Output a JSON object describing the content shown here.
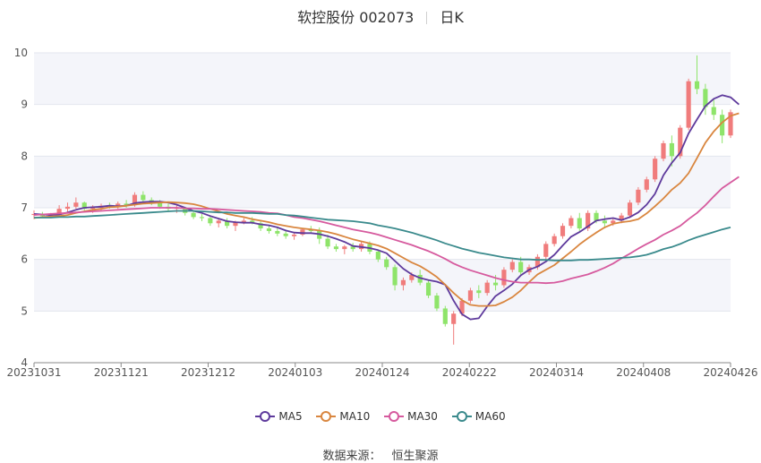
{
  "header": {
    "title": "软控股份 002073",
    "period": "日K"
  },
  "source": {
    "label": "数据来源：",
    "value": "恒生聚源"
  },
  "chart_data": {
    "type": "candlestick",
    "ylim": [
      4,
      10
    ],
    "yticks": [
      4,
      5,
      6,
      7,
      8,
      9,
      10
    ],
    "xtick_labels": [
      "20231031",
      "20231121",
      "20231212",
      "20240103",
      "20240124",
      "20240222",
      "20240314",
      "20240408",
      "20240426"
    ],
    "grid": true,
    "legend_position": "bottom-center",
    "colors": {
      "up": "#f07c7c",
      "down": "#8ee46a",
      "band": "#f4f5fa"
    },
    "ohlc": [
      [
        6.86,
        6.95,
        6.78,
        6.88
      ],
      [
        6.88,
        6.92,
        6.82,
        6.84
      ],
      [
        6.84,
        6.9,
        6.8,
        6.86
      ],
      [
        6.86,
        7.05,
        6.85,
        6.98
      ],
      [
        6.98,
        7.1,
        6.92,
        7.02
      ],
      [
        7.02,
        7.2,
        6.98,
        7.1
      ],
      [
        7.1,
        7.12,
        6.95,
        6.98
      ],
      [
        6.98,
        7.05,
        6.9,
        7.0
      ],
      [
        7.0,
        7.08,
        6.95,
        7.04
      ],
      [
        7.04,
        7.1,
        6.98,
        7.02
      ],
      [
        7.02,
        7.12,
        6.98,
        7.08
      ],
      [
        7.08,
        7.15,
        7.0,
        7.05
      ],
      [
        7.05,
        7.3,
        7.02,
        7.25
      ],
      [
        7.25,
        7.32,
        7.1,
        7.15
      ],
      [
        7.15,
        7.2,
        7.05,
        7.1
      ],
      [
        7.1,
        7.15,
        6.98,
        7.02
      ],
      [
        7.02,
        7.08,
        6.92,
        6.98
      ],
      [
        6.98,
        7.05,
        6.9,
        7.0
      ],
      [
        7.0,
        7.02,
        6.85,
        6.9
      ],
      [
        6.9,
        6.95,
        6.78,
        6.82
      ],
      [
        6.82,
        6.88,
        6.74,
        6.8
      ],
      [
        6.8,
        6.85,
        6.65,
        6.7
      ],
      [
        6.7,
        6.78,
        6.62,
        6.75
      ],
      [
        6.75,
        6.8,
        6.6,
        6.65
      ],
      [
        6.65,
        6.75,
        6.55,
        6.72
      ],
      [
        6.72,
        6.8,
        6.68,
        6.75
      ],
      [
        6.75,
        6.82,
        6.68,
        6.7
      ],
      [
        6.7,
        6.75,
        6.55,
        6.6
      ],
      [
        6.6,
        6.66,
        6.5,
        6.55
      ],
      [
        6.55,
        6.62,
        6.45,
        6.5
      ],
      [
        6.5,
        6.55,
        6.4,
        6.45
      ],
      [
        6.45,
        6.52,
        6.38,
        6.48
      ],
      [
        6.48,
        6.6,
        6.45,
        6.58
      ],
      [
        6.58,
        6.65,
        6.5,
        6.55
      ],
      [
        6.55,
        6.62,
        6.3,
        6.4
      ],
      [
        6.4,
        6.48,
        6.2,
        6.25
      ],
      [
        6.25,
        6.3,
        6.15,
        6.2
      ],
      [
        6.2,
        6.28,
        6.1,
        6.25
      ],
      [
        6.25,
        6.32,
        6.15,
        6.2
      ],
      [
        6.2,
        6.35,
        6.15,
        6.3
      ],
      [
        6.3,
        6.35,
        6.1,
        6.15
      ],
      [
        6.15,
        6.18,
        5.95,
        6.0
      ],
      [
        6.0,
        6.05,
        5.8,
        5.85
      ],
      [
        5.85,
        5.9,
        5.4,
        5.5
      ],
      [
        5.5,
        5.65,
        5.4,
        5.6
      ],
      [
        5.6,
        5.75,
        5.55,
        5.7
      ],
      [
        5.7,
        5.8,
        5.5,
        5.55
      ],
      [
        5.55,
        5.6,
        5.25,
        5.3
      ],
      [
        5.3,
        5.35,
        5.0,
        5.05
      ],
      [
        5.05,
        5.1,
        4.7,
        4.75
      ],
      [
        4.75,
        5.0,
        4.35,
        4.95
      ],
      [
        4.95,
        5.25,
        4.9,
        5.2
      ],
      [
        5.2,
        5.45,
        5.15,
        5.4
      ],
      [
        5.4,
        5.5,
        5.25,
        5.35
      ],
      [
        5.35,
        5.6,
        5.3,
        5.55
      ],
      [
        5.55,
        5.7,
        5.4,
        5.5
      ],
      [
        5.5,
        5.85,
        5.45,
        5.8
      ],
      [
        5.8,
        6.0,
        5.75,
        5.95
      ],
      [
        5.95,
        6.05,
        5.7,
        5.75
      ],
      [
        5.75,
        5.9,
        5.7,
        5.85
      ],
      [
        5.85,
        6.1,
        5.8,
        6.05
      ],
      [
        6.05,
        6.35,
        6.0,
        6.3
      ],
      [
        6.3,
        6.5,
        6.25,
        6.45
      ],
      [
        6.45,
        6.7,
        6.4,
        6.65
      ],
      [
        6.65,
        6.85,
        6.6,
        6.8
      ],
      [
        6.8,
        6.9,
        6.55,
        6.6
      ],
      [
        6.6,
        6.95,
        6.55,
        6.9
      ],
      [
        6.9,
        6.95,
        6.7,
        6.75
      ],
      [
        6.75,
        6.85,
        6.6,
        6.7
      ],
      [
        6.7,
        6.8,
        6.65,
        6.75
      ],
      [
        6.75,
        6.9,
        6.7,
        6.85
      ],
      [
        6.85,
        7.15,
        6.8,
        7.1
      ],
      [
        7.1,
        7.4,
        7.05,
        7.35
      ],
      [
        7.35,
        7.6,
        7.3,
        7.55
      ],
      [
        7.55,
        8.0,
        7.5,
        7.95
      ],
      [
        7.95,
        8.3,
        7.9,
        8.25
      ],
      [
        8.25,
        8.4,
        7.8,
        8.0
      ],
      [
        8.0,
        8.6,
        7.95,
        8.55
      ],
      [
        8.55,
        9.5,
        8.5,
        9.45
      ],
      [
        9.45,
        9.95,
        9.2,
        9.3
      ],
      [
        9.3,
        9.4,
        8.8,
        8.95
      ],
      [
        8.95,
        9.1,
        8.7,
        8.8
      ],
      [
        8.8,
        8.9,
        8.25,
        8.4
      ],
      [
        8.4,
        8.9,
        8.35,
        8.85
      ]
    ],
    "series": [
      {
        "name": "MA5",
        "color": "#5e3a9c",
        "values": [
          6.88,
          6.87,
          6.86,
          6.87,
          6.91,
          6.96,
          7.0,
          7.01,
          7.02,
          7.04,
          7.03,
          7.04,
          7.09,
          7.11,
          7.12,
          7.12,
          7.1,
          7.06,
          7.0,
          6.94,
          6.9,
          6.84,
          6.79,
          6.74,
          6.72,
          6.71,
          6.71,
          6.68,
          6.66,
          6.62,
          6.56,
          6.52,
          6.51,
          6.51,
          6.49,
          6.45,
          6.4,
          6.34,
          6.26,
          6.24,
          6.22,
          6.18,
          6.12,
          5.97,
          5.82,
          5.71,
          5.64,
          5.6,
          5.57,
          5.51,
          5.2,
          4.94,
          4.84,
          4.86,
          5.09,
          5.29,
          5.4,
          5.52,
          5.69,
          5.8,
          5.86,
          5.96,
          6.09,
          6.27,
          6.44,
          6.53,
          6.64,
          6.75,
          6.78,
          6.8,
          6.76,
          6.82,
          6.91,
          7.06,
          7.27,
          7.63,
          7.87,
          8.07,
          8.44,
          8.71,
          8.97,
          9.11,
          9.18,
          9.14,
          9.0
        ]
      },
      {
        "name": "MA10",
        "color": "#d9863f",
        "values": [
          6.8,
          6.82,
          6.83,
          6.84,
          6.86,
          6.9,
          6.93,
          6.96,
          6.98,
          7.01,
          7.02,
          7.04,
          7.06,
          7.08,
          7.09,
          7.1,
          7.11,
          7.1,
          7.09,
          7.07,
          7.03,
          6.98,
          6.93,
          6.88,
          6.85,
          6.82,
          6.78,
          6.75,
          6.72,
          6.68,
          6.65,
          6.62,
          6.6,
          6.58,
          6.56,
          6.53,
          6.49,
          6.44,
          6.39,
          6.35,
          6.31,
          6.27,
          6.21,
          6.12,
          6.03,
          5.94,
          5.87,
          5.77,
          5.66,
          5.51,
          5.35,
          5.21,
          5.12,
          5.1,
          5.1,
          5.11,
          5.18,
          5.27,
          5.4,
          5.56,
          5.71,
          5.8,
          5.89,
          6.02,
          6.15,
          6.29,
          6.41,
          6.52,
          6.62,
          6.69,
          6.72,
          6.74,
          6.78,
          6.89,
          7.03,
          7.18,
          7.35,
          7.48,
          7.67,
          7.96,
          8.26,
          8.48,
          8.65,
          8.78,
          8.83
        ]
      },
      {
        "name": "MA30",
        "color": "#d65a9e",
        "values": [
          6.86,
          6.87,
          6.88,
          6.89,
          6.9,
          6.91,
          6.92,
          6.93,
          6.94,
          6.95,
          6.96,
          6.97,
          6.98,
          6.99,
          7.0,
          7.0,
          7.0,
          7.0,
          6.99,
          6.99,
          6.98,
          6.98,
          6.97,
          6.96,
          6.95,
          6.94,
          6.93,
          6.92,
          6.9,
          6.89,
          6.86,
          6.82,
          6.8,
          6.77,
          6.74,
          6.7,
          6.66,
          6.62,
          6.58,
          6.55,
          6.52,
          6.48,
          6.43,
          6.38,
          6.33,
          6.28,
          6.22,
          6.16,
          6.09,
          6.01,
          5.92,
          5.85,
          5.79,
          5.74,
          5.69,
          5.64,
          5.6,
          5.57,
          5.55,
          5.55,
          5.55,
          5.54,
          5.55,
          5.58,
          5.63,
          5.67,
          5.71,
          5.77,
          5.84,
          5.92,
          6.02,
          6.11,
          6.21,
          6.3,
          6.38,
          6.48,
          6.56,
          6.65,
          6.78,
          6.9,
          7.05,
          7.22,
          7.38,
          7.49,
          7.6
        ]
      },
      {
        "name": "MA60",
        "color": "#3a8a8c",
        "values": [
          6.81,
          6.81,
          6.81,
          6.82,
          6.82,
          6.83,
          6.83,
          6.84,
          6.85,
          6.86,
          6.87,
          6.88,
          6.89,
          6.9,
          6.91,
          6.92,
          6.93,
          6.94,
          6.94,
          6.94,
          6.93,
          6.92,
          6.91,
          6.91,
          6.9,
          6.9,
          6.9,
          6.89,
          6.88,
          6.88,
          6.86,
          6.85,
          6.83,
          6.81,
          6.79,
          6.77,
          6.76,
          6.75,
          6.74,
          6.72,
          6.7,
          6.66,
          6.63,
          6.6,
          6.56,
          6.52,
          6.47,
          6.42,
          6.37,
          6.31,
          6.26,
          6.21,
          6.17,
          6.13,
          6.1,
          6.07,
          6.04,
          6.02,
          6.0,
          6.0,
          5.99,
          5.99,
          5.98,
          5.98,
          5.98,
          5.99,
          5.99,
          6.0,
          6.01,
          6.02,
          6.03,
          6.04,
          6.06,
          6.09,
          6.14,
          6.2,
          6.24,
          6.3,
          6.37,
          6.43,
          6.48,
          6.53,
          6.58,
          6.62
        ]
      }
    ]
  }
}
